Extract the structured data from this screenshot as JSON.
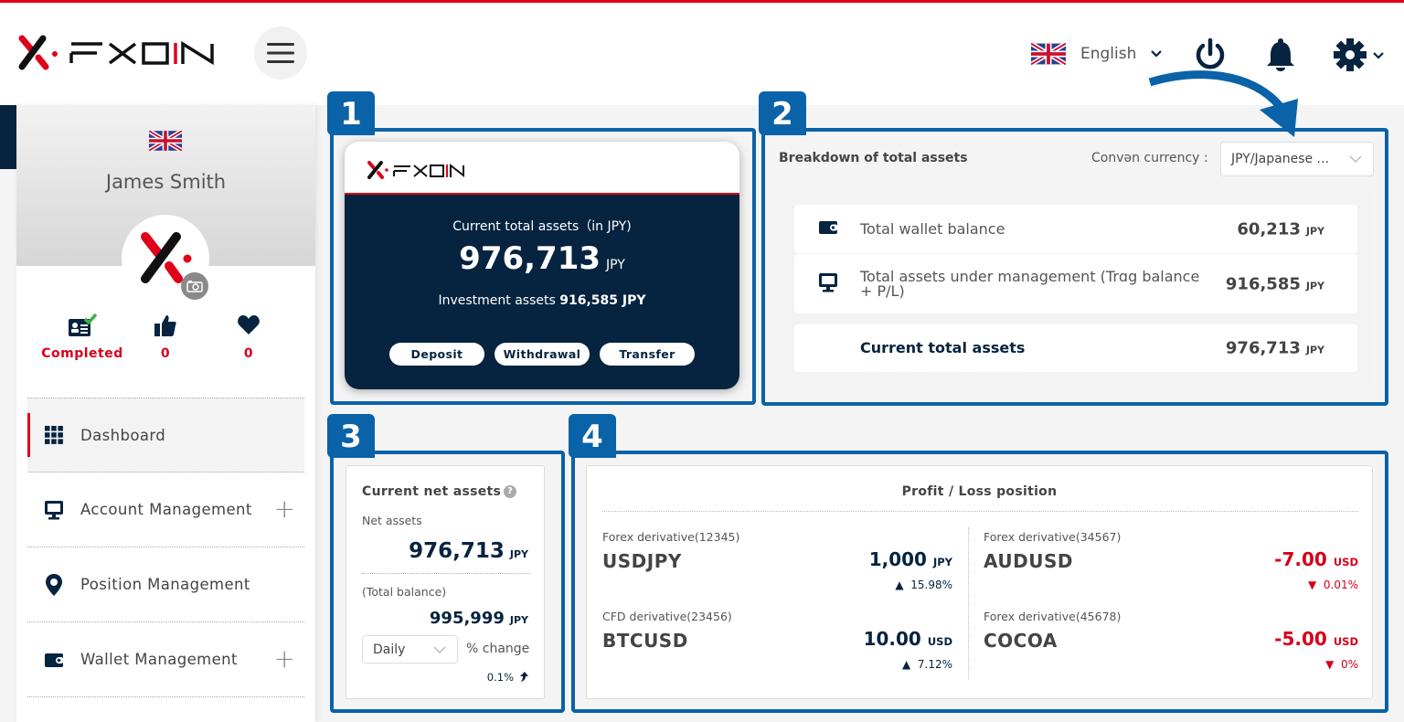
{
  "header": {
    "brand": "FXON",
    "menu_button": "menu",
    "language": {
      "label": "English",
      "flag": "uk-flag"
    },
    "icons": [
      "power-icon",
      "bell-icon",
      "gear-icon"
    ]
  },
  "profile": {
    "name": "James Smith",
    "flag": "uk-flag",
    "stats": [
      {
        "icon": "id-card-check-icon",
        "value": "Completed"
      },
      {
        "icon": "thumbs-up-icon",
        "value": "0"
      },
      {
        "icon": "heart-icon",
        "value": "0"
      }
    ]
  },
  "sidebar": {
    "items": [
      {
        "label": "Dashboard",
        "icon": "grid-icon",
        "active": true,
        "expandable": false
      },
      {
        "label": "Account Management",
        "icon": "monitor-icon",
        "active": false,
        "expandable": true
      },
      {
        "label": "Position Management",
        "icon": "map-pin-icon",
        "active": false,
        "expandable": false
      },
      {
        "label": "Wallet Management",
        "icon": "wallet-icon",
        "active": false,
        "expandable": true
      }
    ]
  },
  "callouts": [
    "1",
    "2",
    "3",
    "4"
  ],
  "panel1": {
    "brand": "FXON",
    "label": "Current total assets（in JPY)",
    "amount": "976,713",
    "unit": "JPY",
    "investment_label": "Investment assets",
    "investment_value": "916,585 JPY",
    "buttons": [
      "Deposit",
      "Withdrawal",
      "Transfer"
    ]
  },
  "panel2": {
    "title": "Breakdown of total assets",
    "conversion_label": "Convǝn currency :",
    "conversion_value": "JPY/Japanese ...",
    "rows": [
      {
        "icon": "wallet-icon",
        "label": "Total wallet balance",
        "value": "60,213",
        "unit": "JPY"
      },
      {
        "icon": "monitor-icon",
        "label": "Total assets under management (Trɑg balance\n+ P/L)",
        "value": "916,585",
        "unit": "JPY"
      },
      {
        "icon": "",
        "label": "Current total assets",
        "value": "976,713",
        "unit": "JPY"
      }
    ]
  },
  "panel3": {
    "title": "Current net assets",
    "help": "?",
    "net_label": "Net assets",
    "net_value": "976,713",
    "net_unit": "JPY",
    "balance_label": "(Total balance)",
    "balance_value": "995,999",
    "balance_unit": "JPY",
    "period": "Daily",
    "change_label": "% change",
    "change_value": "0.1%"
  },
  "panel4": {
    "title": "Profit / Loss position",
    "positions": [
      {
        "account": "Forex derivative(12345)",
        "symbol": "USDJPY",
        "amount": "1,000",
        "unit": "JPY",
        "change": "15.98%",
        "direction": "up"
      },
      {
        "account": "CFD derivative(23456)",
        "symbol": "BTCUSD",
        "amount": "10.00",
        "unit": "USD",
        "change": "7.12%",
        "direction": "up"
      },
      {
        "account": "Forex derivative(34567)",
        "symbol": "AUDUSD",
        "amount": "-7.00",
        "unit": "USD",
        "change": "0.01%",
        "direction": "down"
      },
      {
        "account": "Forex derivative(45678)",
        "symbol": "COCOA",
        "amount": "-5.00",
        "unit": "USD",
        "change": "0%",
        "direction": "down"
      }
    ]
  },
  "colors": {
    "brand_red": "#e0001a",
    "navy": "#06233f",
    "callout_blue": "#0a62a8",
    "loss_red": "#d6001c"
  }
}
